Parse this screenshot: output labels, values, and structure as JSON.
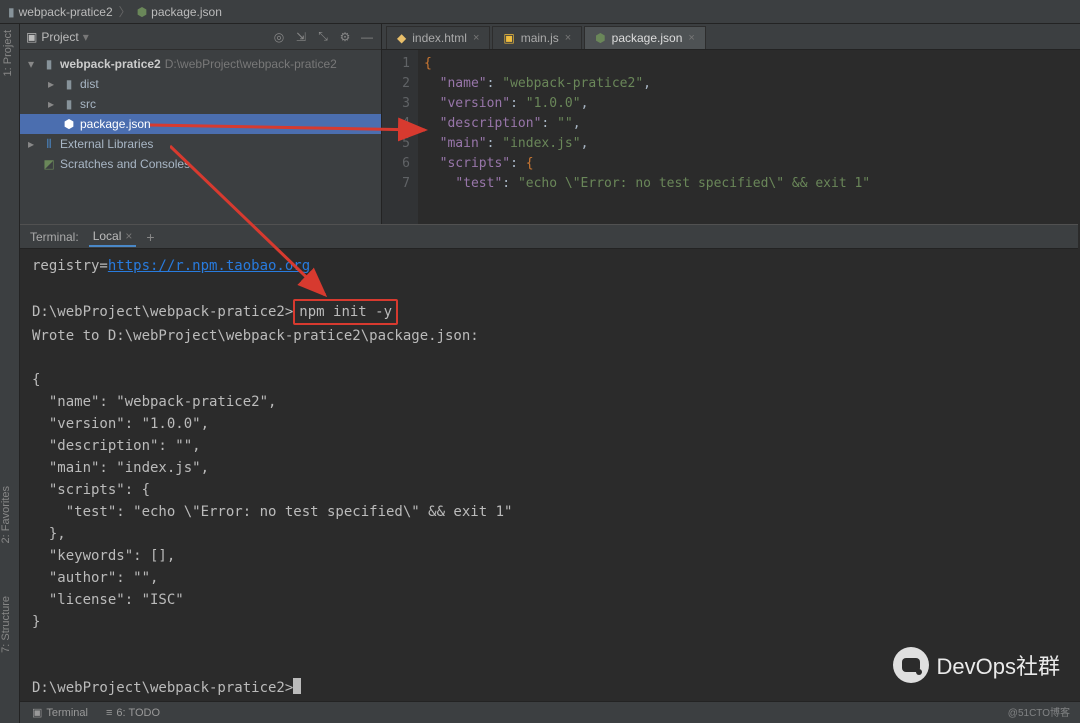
{
  "breadcrumb": {
    "project": "webpack-pratice2",
    "file": "package.json"
  },
  "project_panel": {
    "title": "Project",
    "root": {
      "name": "webpack-pratice2",
      "path": "D:\\webProject\\webpack-pratice2"
    },
    "dist": "dist",
    "src": "src",
    "package_json": "package.json",
    "ext_lib": "External Libraries",
    "scratches": "Scratches and Consoles"
  },
  "tabs": [
    {
      "label": "index.html",
      "kind": "html"
    },
    {
      "label": "main.js",
      "kind": "js"
    },
    {
      "label": "package.json",
      "kind": "json",
      "active": true
    }
  ],
  "editor": {
    "lines": [
      1,
      2,
      3,
      4,
      5,
      6,
      7
    ],
    "code": {
      "l1": "{",
      "l2k": "\"name\"",
      "l2v": "\"webpack-pratice2\"",
      "l3k": "\"version\"",
      "l3v": "\"1.0.0\"",
      "l4k": "\"description\"",
      "l4v": "\"\"",
      "l5k": "\"main\"",
      "l5v": "\"index.js\"",
      "l6k": "\"scripts\"",
      "l7k": "\"test\"",
      "l7v": "\"echo \\\"Error: no test specified\\\" && exit 1\""
    }
  },
  "terminal": {
    "header": "Terminal:",
    "tab": "Local",
    "registry_label": "registry=",
    "registry_url": "https://r.npm.taobao.org",
    "prompt1_pre": "D:\\webProject\\webpack-pratice2>",
    "cmd": "npm init -y",
    "wrote": "Wrote to D:\\webProject\\webpack-pratice2\\package.json:",
    "json_block": "{\n  \"name\": \"webpack-pratice2\",\n  \"version\": \"1.0.0\",\n  \"description\": \"\",\n  \"main\": \"index.js\",\n  \"scripts\": {\n    \"test\": \"echo \\\"Error: no test specified\\\" && exit 1\"\n  },\n  \"keywords\": [],\n  \"author\": \"\",\n  \"license\": \"ISC\"\n}",
    "prompt2": "D:\\webProject\\webpack-pratice2>"
  },
  "statusbar": {
    "terminal": "Terminal",
    "todo": "6: TODO"
  },
  "side": {
    "project": "1: Project",
    "favorites": "2: Favorites",
    "structure": "7: Structure"
  },
  "watermark": {
    "text": "DevOps社群",
    "small": "@51CTO博客"
  }
}
